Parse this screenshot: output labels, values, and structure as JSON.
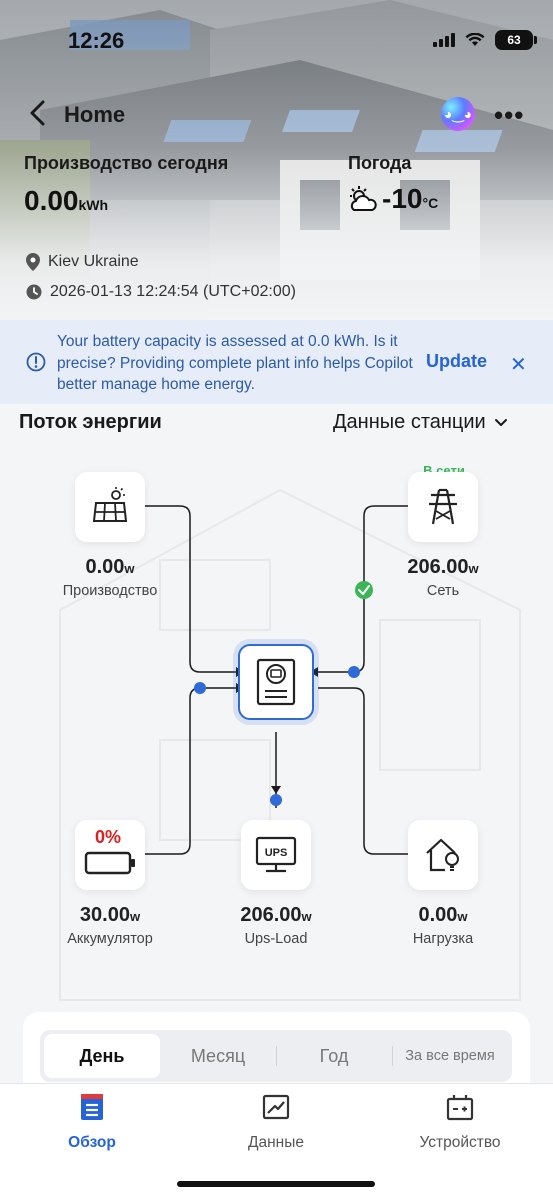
{
  "status_bar": {
    "time": "12:26",
    "battery": "63"
  },
  "header": {
    "title": "Home"
  },
  "summary": {
    "production_label": "Производство сегодня",
    "production_value": "0.00",
    "production_unit": "kWh",
    "weather_label": "Погода",
    "weather_temp": "-10",
    "weather_unit": "°C",
    "location": "Kiev Ukraine",
    "datetime": "2026-01-13 12:24:54 (UTC+02:00)"
  },
  "banner": {
    "text": "Your battery capacity is assessed at 0.0 kWh. Is it precise? Providing complete plant info helps Copilot better manage home energy.",
    "action": "Update"
  },
  "flow": {
    "title": "Поток энергии",
    "dropdown": "Данные станции",
    "nodes": {
      "production": {
        "value": "0.00",
        "unit": "w",
        "label": "Производство"
      },
      "grid": {
        "value": "206.00",
        "unit": "w",
        "label": "Сеть",
        "status": "В сети"
      },
      "battery": {
        "value": "30.00",
        "unit": "w",
        "label": "Аккумулятор",
        "percent": "0%"
      },
      "ups_load": {
        "value": "206.00",
        "unit": "w",
        "label": "Ups-Load",
        "icon_text": "UPS"
      },
      "load": {
        "value": "0.00",
        "unit": "w",
        "label": "Нагрузка"
      }
    }
  },
  "period_tabs": [
    "День",
    "Месяц",
    "Год",
    "За все время"
  ],
  "bottom_nav": [
    {
      "label": "Обзор",
      "icon": "overview-icon",
      "active": true
    },
    {
      "label": "Данные",
      "icon": "chart-icon",
      "active": false
    },
    {
      "label": "Устройство",
      "icon": "device-icon",
      "active": false
    }
  ],
  "colors": {
    "accent": "#2563d8",
    "online": "#3cb45a",
    "battery_low": "#e02020"
  }
}
